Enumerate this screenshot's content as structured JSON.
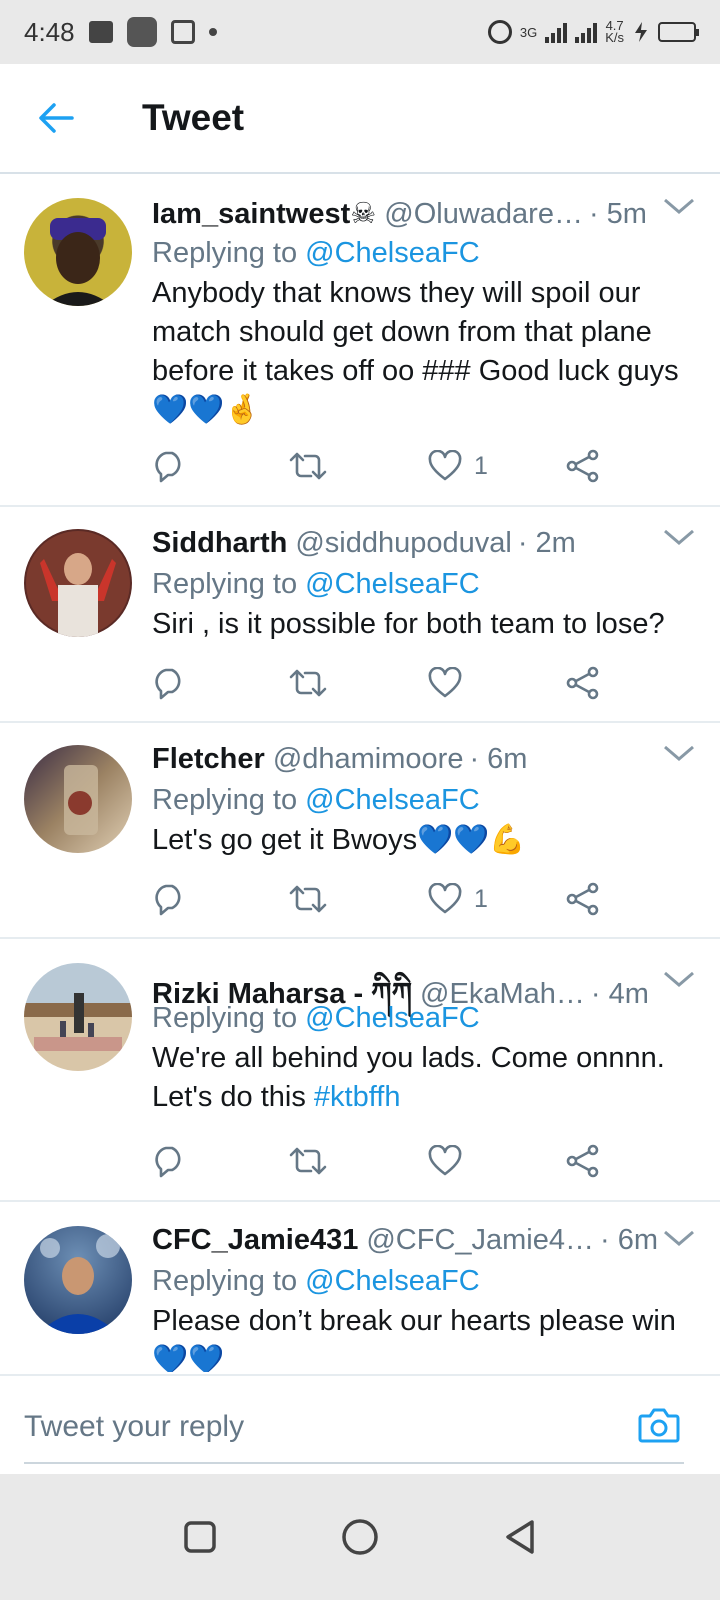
{
  "status_bar": {
    "time": "4:48",
    "network": "3G",
    "speed_value": "4.7",
    "speed_unit": "K/s"
  },
  "header": {
    "title": "Tweet",
    "back_icon": "arrow-left-icon"
  },
  "colors": {
    "accent": "#1da1f2",
    "link": "#1b95e0",
    "secondary_text": "#657786",
    "primary_text": "#14171a",
    "divider": "#e6ecf0"
  },
  "tweets": [
    {
      "name": "Iam_saintwest☠",
      "handle": "@Oluwadare…",
      "time": "· 5m",
      "replying_prefix": "Replying to",
      "replying_to": "@ChelseaFC",
      "text": "Anybody that knows they will spoil our match should get down from that plane before it takes off oo ### Good luck guys 💙💙🤞",
      "like_count": "1"
    },
    {
      "name": "Siddharth",
      "handle": "@siddhupoduval",
      "time": "· 2m",
      "replying_prefix": "Replying to",
      "replying_to": "@ChelseaFC",
      "text": "Siri , is it possible for both team to lose?",
      "like_count": ""
    },
    {
      "name": "Fletcher",
      "handle": "@dhamimoore",
      "time": "· 6m",
      "replying_prefix": "Replying to",
      "replying_to": "@ChelseaFC",
      "text": "Let's go get it Bwoys💙💙💪",
      "like_count": "1"
    },
    {
      "name": "Rizki Maharsa - ཀིཀི",
      "handle": "@EkaMah…",
      "time": "· 4m",
      "replying_prefix": "Replying to",
      "replying_to": "@ChelseaFC",
      "text_prefix": "We're all behind you lads. Come onnnn. Let's do this ",
      "hashtag": "#ktbffh",
      "like_count": ""
    },
    {
      "name": "CFC_Jamie431",
      "handle": "@CFC_Jamie4…",
      "time": "· 6m",
      "replying_prefix": "Replying to",
      "replying_to": "@ChelseaFC",
      "text": "Please don’t break our hearts please win 💙💙",
      "like_count": ""
    }
  ],
  "composer": {
    "placeholder": "Tweet your reply",
    "camera_icon": "camera-icon"
  },
  "nav_bar": {
    "items": [
      "recents-square-icon",
      "home-circle-icon",
      "back-triangle-icon"
    ]
  }
}
